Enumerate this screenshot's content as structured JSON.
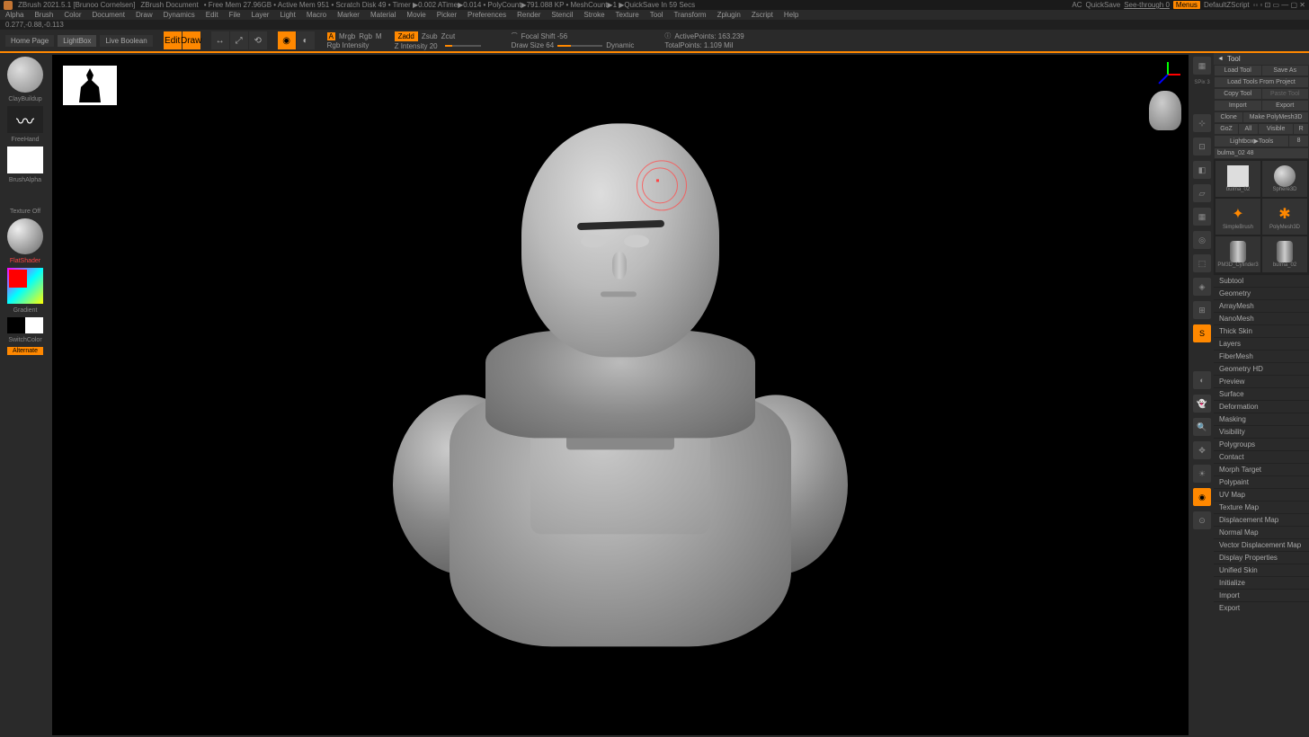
{
  "titlebar": {
    "app": "ZBrush 2021.5.1 [Brunoo Cornelsen]",
    "doc": "ZBrush Document",
    "stats": "• Free Mem 27.96GB • Active Mem 951 • Scratch Disk 49 • Timer ▶0.002 ATime▶0.014 • PolyCount▶791.088 KP • MeshCount▶1 ▶QuickSave In 59 Secs",
    "ac": "AC",
    "quicksave": "QuickSave",
    "seethrough": "See-through  0",
    "menus": "Menus",
    "script": "DefaultZScript"
  },
  "menubar": [
    "Alpha",
    "Brush",
    "Color",
    "Document",
    "Draw",
    "Dynamics",
    "Edit",
    "File",
    "Layer",
    "Light",
    "Macro",
    "Marker",
    "Material",
    "Movie",
    "Picker",
    "Preferences",
    "Render",
    "Stencil",
    "Stroke",
    "Texture",
    "Tool",
    "Transform",
    "Zplugin",
    "Zscript",
    "Help"
  ],
  "coords": "0.277,-0.88,-0.113",
  "topbar": {
    "homepage": "Home Page",
    "lightbox": "LightBox",
    "liveboolean": "Live Boolean",
    "edit": "Edit",
    "draw": "Draw",
    "mrgb": "Mrgb",
    "rgb": "Rgb",
    "m": "M",
    "rgbint": "Rgb Intensity",
    "zadd": "Zadd",
    "zsub": "Zsub",
    "zcut": "Zcut",
    "zint": "Z Intensity 20",
    "focal": "Focal Shift -56",
    "drawsize": "Draw Size 64",
    "dynamic": "Dynamic",
    "activepoints": "ActivePoints: 163.239",
    "totalpoints": "TotalPoints: 1.109 Mil"
  },
  "leftbar": {
    "brush": "ClayBuildup",
    "stroke": "FreeHand",
    "alpha": "BrushAlpha",
    "texture": "Texture Off",
    "material": "FlatShader",
    "gradient": "Gradient",
    "switch": "SwitchColor",
    "alternate": "Alternate"
  },
  "iconbar": {
    "spx": "SPix 3",
    "items": [
      "BRP",
      "Scroll",
      "Actual",
      "AAHalf",
      "Persp",
      "Floor",
      "Local",
      "1.5m",
      "Xpose",
      "PF",
      "Transp",
      "Ghost",
      "Solo",
      "Zoom3D",
      "LiteTk",
      "LiteOp",
      "Transp",
      "Polyframe"
    ]
  },
  "rightpanel": {
    "title": "Tool",
    "loadtool": "Load Tool",
    "saveas": "Save As",
    "loadproject": "Load Tools From Project",
    "copytool": "Copy Tool",
    "pastetool": "Paste Tool",
    "import": "Import",
    "export": "Export",
    "clone": "Clone",
    "makepm": "Make PolyMesh3D",
    "goz": "GoZ",
    "all": "All",
    "visible": "Visible",
    "r": "R",
    "lightbox": "Lightbox▶Tools",
    "toolname": "bulma_02  48",
    "tools": [
      {
        "name": "bulma_02"
      },
      {
        "name": "Sphere3D"
      },
      {
        "name": "SimpleBrush"
      },
      {
        "name": "PolyMesh3D"
      },
      {
        "name": "PM3D_Cylinder3"
      },
      {
        "name": "bulma_02"
      }
    ],
    "palettes": [
      "Subtool",
      "Geometry",
      "ArrayMesh",
      "NanoMesh",
      "Thick Skin",
      "Layers",
      "FiberMesh",
      "Geometry HD",
      "Preview",
      "Surface",
      "Deformation",
      "Masking",
      "Visibility",
      "Polygroups",
      "Contact",
      "Morph Target",
      "Polypaint",
      "UV Map",
      "Texture Map",
      "Displacement Map",
      "Normal Map",
      "Vector Displacement Map",
      "Display Properties",
      "Unified Skin",
      "Initialize",
      "Import",
      "Export"
    ]
  }
}
